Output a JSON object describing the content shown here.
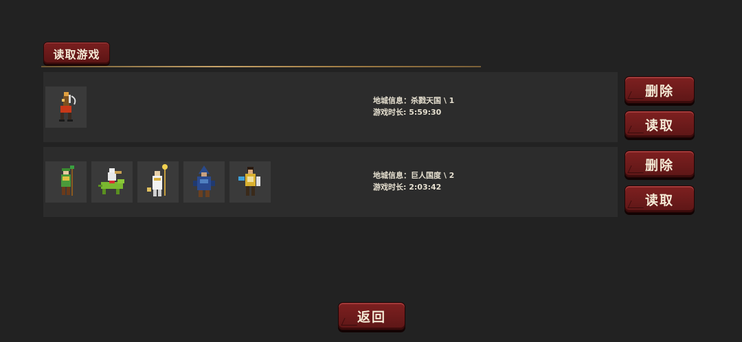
{
  "header": {
    "title": "读取游戏"
  },
  "saves": [
    {
      "heroes": [
        "orange-warrior-sprite"
      ],
      "dungeon_label": "地城信息：",
      "dungeon_value": "杀戮天国 \\ 1",
      "time_label": "游戏时长: ",
      "time_value": "5:59:30",
      "delete_label": "删除",
      "load_label": "读取"
    },
    {
      "heroes": [
        "green-druid-sprite",
        "lizard-rider-sprite",
        "white-priest-sprite",
        "blue-mage-sprite",
        "gold-paladin-sprite"
      ],
      "dungeon_label": "地城信息：",
      "dungeon_value": "巨人国度 \\ 2",
      "time_label": "游戏时长: ",
      "time_value": "2:03:42",
      "delete_label": "删除",
      "load_label": "读取"
    }
  ],
  "footer": {
    "back_label": "返回"
  },
  "colors": {
    "background": "#222222",
    "slot": "#2c2c2c",
    "button": "#6e1c1c",
    "gold": "#c9a56a"
  }
}
